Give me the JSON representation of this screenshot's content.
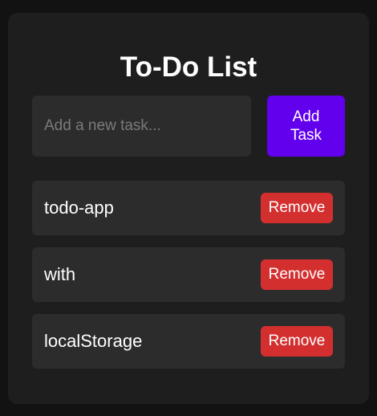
{
  "app": {
    "title": "To-Do List"
  },
  "input": {
    "placeholder": "Add a new task...",
    "value": ""
  },
  "add_button": {
    "label": "Add Task"
  },
  "tasks": [
    {
      "text": "todo-app",
      "remove_label": "Remove"
    },
    {
      "text": "with",
      "remove_label": "Remove"
    },
    {
      "text": "localStorage",
      "remove_label": "Remove"
    }
  ],
  "colors": {
    "page_bg": "#121212",
    "card_bg": "#1e1e1e",
    "field_bg": "#2c2c2c",
    "accent": "#6200ee",
    "danger": "#d32f2f",
    "text": "#ffffff",
    "placeholder": "#7a7a7a"
  }
}
